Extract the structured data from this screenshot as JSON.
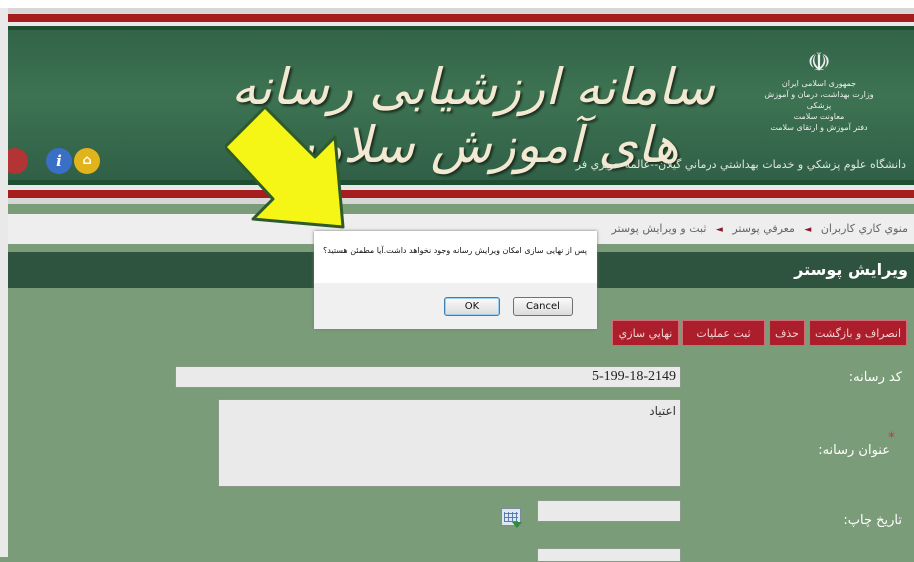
{
  "header": {
    "title": "سامانه ارزشیابی رسانه های آموزش سلامت",
    "subtitle": "دانشگاه علوم پزشكي و خدمات بهداشتي درماني گيلان--عالمه حريري فر",
    "emblem": {
      "mark": "☫",
      "lines": [
        "جمهوری اسلامی ایران",
        "وزارت بهداشت، درمان و آموزش پزشکی",
        "معاونت سلامت",
        "دفتر آموزش و ارتقای سلامت"
      ]
    }
  },
  "breadcrumb": [
    "منوي كاري كاربران",
    "معرفي پوستر",
    "ثبت و ويرايش پوستر"
  ],
  "page_title": "ويرايش پوستر",
  "actions": {
    "cancel_return": "انصراف و بازگشت",
    "delete": "حذف",
    "register_ops": "ثبت عمليات",
    "finalize": "نهايي سازي"
  },
  "form": {
    "code_label": "كد رسانه:",
    "code_value": "5-199-18-2149",
    "title_label": "عنوان رسانه:",
    "title_value": "اعتياد",
    "date_label": "تاريخ چاپ:",
    "date_value": ""
  },
  "dialog": {
    "message": "پس از نهایی سازی امکان ویرایش رسانه وجود نخواهد داشت.آیا مطمئن هستید؟",
    "ok_label": "OK",
    "cancel_label": "Cancel"
  },
  "icons": {
    "info": "i",
    "home": "⌂",
    "help": ""
  },
  "colors": {
    "header_green": "#3d7352",
    "accent_red": "#ad1e2c",
    "page_green": "#7a9c78",
    "arrow_yellow": "#f5f516"
  }
}
